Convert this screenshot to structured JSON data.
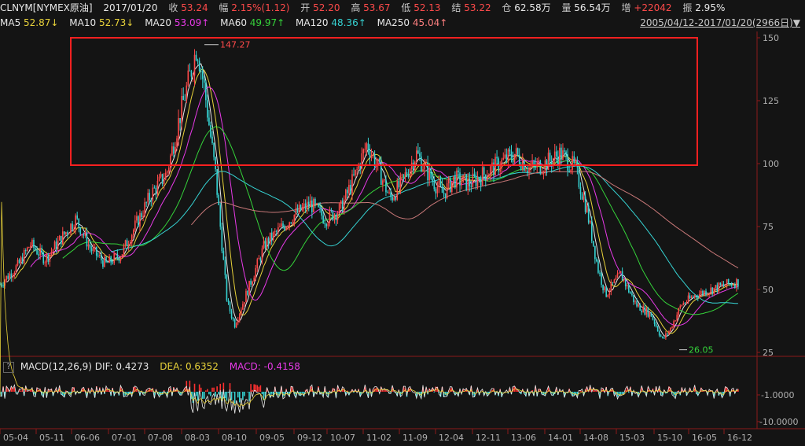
{
  "header": {
    "symbol": "CLNYM[NYMEX原油]",
    "date": "2017/01/20",
    "close_label": "收",
    "close": "53.24",
    "change_label": "幅",
    "change": "2.15%(1.12)",
    "open_label": "开",
    "open": "52.20",
    "high_label": "高",
    "high": "53.67",
    "low_label": "低",
    "low": "52.13",
    "settle_label": "结",
    "settle": "53.22",
    "oi_label": "仓",
    "oi": "62.58万",
    "vol_label": "量",
    "vol": "56.54万",
    "inc_label": "增",
    "inc": "+22042",
    "amp_label": "振",
    "amp": "2.95%"
  },
  "ma_bar": {
    "ma5": {
      "label": "MA5",
      "value": "52.87↓"
    },
    "ma10": {
      "label": "MA10",
      "value": "52.73↓"
    },
    "ma20": {
      "label": "MA20",
      "value": "53.09↑"
    },
    "ma60": {
      "label": "MA60",
      "value": "49.97↑"
    },
    "ma120": {
      "label": "MA120",
      "value": "48.36↑"
    },
    "ma250": {
      "label": "MA250",
      "value": "45.04↑"
    },
    "range": "2005/04/12-2017/01/20(2966日)▼"
  },
  "macd": {
    "question": "?",
    "name": "MACD(12,26,9)",
    "dif_label": "DIF:",
    "dif": "0.4273",
    "dea_label": "DEA:",
    "dea": "0.6352",
    "macd_label": "MACD:",
    "macd": "-0.4158",
    "y_ticks": [
      "-1.0000",
      "-10.0000"
    ]
  },
  "colors": {
    "background": "#141414",
    "up": "#ff4a4a",
    "down": "#36d3d3",
    "highlight_box": "#ff2020"
  },
  "chart_data": {
    "type": "candlestick",
    "ylim": [
      25,
      150
    ],
    "y_ticks": [
      "150",
      "125",
      "100",
      "75",
      "50",
      "25"
    ],
    "x_ticks": [
      "05-04",
      "05-11",
      "06-06",
      "07-01",
      "07-08",
      "08-03",
      "08-10",
      "09-05",
      "09-12",
      "10-07",
      "11-02",
      "11-09",
      "12-04",
      "12-11",
      "13-06",
      "14-01",
      "14-08",
      "15-03",
      "15-10",
      "16-05",
      "16-12"
    ],
    "max_annotation": {
      "label": "147.27",
      "value": 147.27
    },
    "min_annotation": {
      "label": "26.05",
      "value": 26.05
    },
    "price_path": [
      [
        0,
        52
      ],
      [
        0.025,
        60
      ],
      [
        0.04,
        68
      ],
      [
        0.06,
        62
      ],
      [
        0.085,
        72
      ],
      [
        0.1,
        78
      ],
      [
        0.12,
        66
      ],
      [
        0.14,
        60
      ],
      [
        0.16,
        64
      ],
      [
        0.18,
        76
      ],
      [
        0.2,
        88
      ],
      [
        0.22,
        96
      ],
      [
        0.24,
        122
      ],
      [
        0.255,
        140
      ],
      [
        0.26,
        147
      ],
      [
        0.27,
        130
      ],
      [
        0.285,
        95
      ],
      [
        0.3,
        45
      ],
      [
        0.31,
        36
      ],
      [
        0.33,
        52
      ],
      [
        0.35,
        68
      ],
      [
        0.37,
        74
      ],
      [
        0.39,
        80
      ],
      [
        0.41,
        84
      ],
      [
        0.43,
        78
      ],
      [
        0.45,
        82
      ],
      [
        0.47,
        96
      ],
      [
        0.485,
        108
      ],
      [
        0.5,
        98
      ],
      [
        0.515,
        86
      ],
      [
        0.53,
        92
      ],
      [
        0.55,
        104
      ],
      [
        0.57,
        94
      ],
      [
        0.585,
        88
      ],
      [
        0.6,
        94
      ],
      [
        0.62,
        92
      ],
      [
        0.64,
        96
      ],
      [
        0.66,
        100
      ],
      [
        0.68,
        104
      ],
      [
        0.7,
        98
      ],
      [
        0.72,
        100
      ],
      [
        0.74,
        104
      ],
      [
        0.76,
        98
      ],
      [
        0.775,
        82
      ],
      [
        0.79,
        58
      ],
      [
        0.8,
        48
      ],
      [
        0.82,
        56
      ],
      [
        0.84,
        44
      ],
      [
        0.86,
        40
      ],
      [
        0.875,
        30
      ],
      [
        0.885,
        34
      ],
      [
        0.9,
        44
      ],
      [
        0.92,
        48
      ],
      [
        0.94,
        50
      ],
      [
        0.96,
        52
      ],
      [
        0.975,
        53
      ]
    ]
  }
}
